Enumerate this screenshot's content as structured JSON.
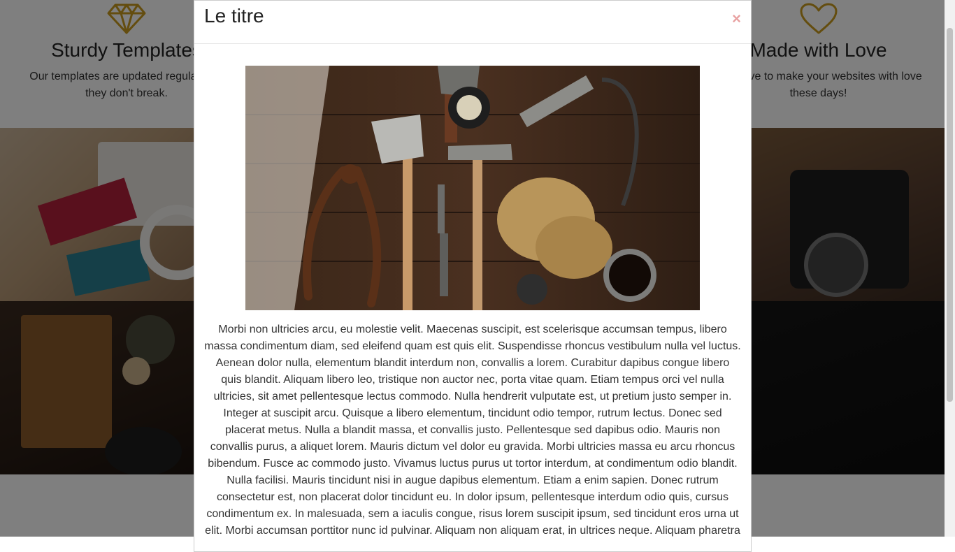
{
  "services": {
    "left": {
      "icon": "diamond-icon",
      "title": "Sturdy Templates",
      "text": "Our templates are updated regularly so they don't break."
    },
    "right": {
      "icon": "heart-icon",
      "title": "Made with Love",
      "text": "You have to make your websites with love these days!"
    }
  },
  "colors": {
    "accent": "#c89b1e",
    "close": "#e8a0a0"
  },
  "modal": {
    "title": "Le titre",
    "close_label": "×",
    "image": "tools-photo",
    "body": "Morbi non ultricies arcu, eu molestie velit. Maecenas suscipit, est scelerisque accumsan tempus, libero massa condimentum diam, sed eleifend quam est quis elit. Suspendisse rhoncus vestibulum nulla vel luctus. Aenean dolor nulla, elementum blandit interdum non, convallis a lorem. Curabitur dapibus congue libero quis blandit. Aliquam libero leo, tristique non auctor nec, porta vitae quam. Etiam tempus orci vel nulla ultricies, sit amet pellentesque lectus commodo. Nulla hendrerit vulputate est, ut pretium justo semper in. Integer at suscipit arcu. Quisque a libero elementum, tincidunt odio tempor, rutrum lectus. Donec sed placerat metus. Nulla a blandit massa, et convallis justo. Pellentesque sed dapibus odio. Mauris non convallis purus, a aliquet lorem. Mauris dictum vel dolor eu gravida. Morbi ultricies massa eu arcu rhoncus bibendum. Fusce ac commodo justo. Vivamus luctus purus ut tortor interdum, at condimentum odio blandit. Nulla facilisi. Mauris tincidunt nisi in augue dapibus elementum. Etiam a enim sapien. Donec rutrum consectetur est, non placerat dolor tincidunt eu. In dolor ipsum, pellentesque interdum odio quis, cursus condimentum ex. In malesuada, sem a iaculis congue, risus lorem suscipit ipsum, sed tincidunt eros urna ut elit. Morbi accumsan porttitor nunc id pulvinar. Aliquam non aliquam erat, in ultrices neque. Aliquam pharetra"
  }
}
